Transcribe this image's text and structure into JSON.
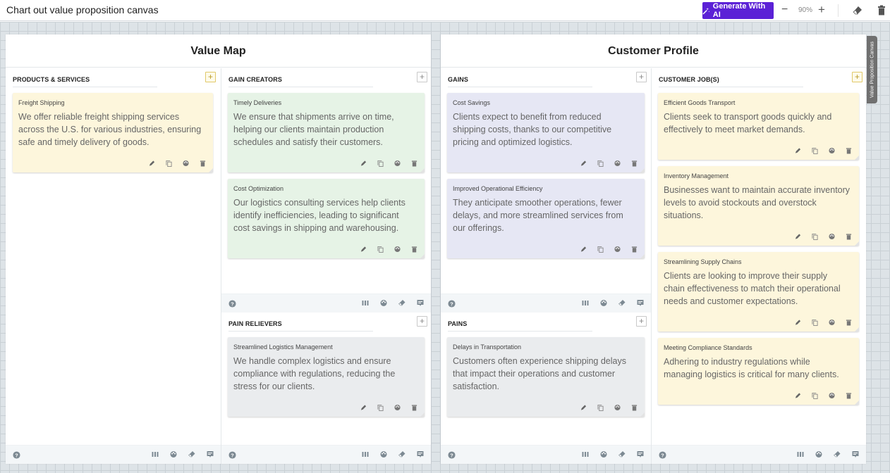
{
  "app": {
    "title": "Chart out value proposition canvas",
    "generate_button": "Generate With AI",
    "zoom_level": "90%",
    "zoom_out_label": "−",
    "zoom_in_label": "+",
    "side_tab": "Value Proposition Canvas"
  },
  "icons": {
    "generate": "magic-wand-icon",
    "eraser": "eraser-icon",
    "trash": "trash-icon",
    "edit": "pencil-icon",
    "copy": "copy-icon",
    "palette": "palette-icon",
    "help": "help-icon",
    "columns": "columns-icon",
    "comment": "comment-icon"
  },
  "colors": {
    "accent": "#5b21d6",
    "card_yellow": "#fdf6dc",
    "card_green": "#e6f3e6",
    "card_purple": "#e6e7f4",
    "card_gray": "#eaecee"
  },
  "value_map": {
    "title": "Value Map",
    "products_services": {
      "header": "PRODUCTS & SERVICES",
      "add_label": "+",
      "cards": [
        {
          "title": "Freight Shipping",
          "body": "We offer reliable freight shipping services across the U.S. for various industries, ensuring safe and timely delivery of goods."
        }
      ]
    },
    "gain_creators": {
      "header": "GAIN CREATORS",
      "add_label": "+",
      "cards": [
        {
          "title": "Timely Deliveries",
          "body": "We ensure that shipments arrive on time, helping our clients maintain production schedules and satisfy their customers."
        },
        {
          "title": "Cost Optimization",
          "body": "Our logistics consulting services help clients identify inefficiencies, leading to significant cost savings in shipping and warehousing."
        }
      ]
    },
    "pain_relievers": {
      "header": "PAIN RELIEVERS",
      "add_label": "+",
      "cards": [
        {
          "title": "Streamlined Logistics Management",
          "body": "We handle complex logistics and ensure compliance with regulations, reducing the stress for our clients."
        }
      ]
    }
  },
  "customer_profile": {
    "title": "Customer Profile",
    "gains": {
      "header": "GAINS",
      "add_label": "+",
      "cards": [
        {
          "title": "Cost Savings",
          "body": "Clients expect to benefit from reduced shipping costs, thanks to our competitive pricing and optimized logistics."
        },
        {
          "title": "Improved Operational Efficiency",
          "body": "They anticipate smoother operations, fewer delays, and more streamlined services from our offerings."
        }
      ]
    },
    "pains": {
      "header": "PAINS",
      "add_label": "+",
      "cards": [
        {
          "title": "Delays in Transportation",
          "body": "Customers often experience shipping delays that impact their operations and customer satisfaction."
        }
      ]
    },
    "customer_jobs": {
      "header": "CUSTOMER JOB(S)",
      "add_label": "+",
      "cards": [
        {
          "title": "Efficient Goods Transport",
          "body": "Clients seek to transport goods quickly and effectively to meet market demands."
        },
        {
          "title": "Inventory Management",
          "body": "Businesses want to maintain accurate inventory levels to avoid stockouts and overstock situations."
        },
        {
          "title": "Streamlining Supply Chains",
          "body": "Clients are looking to improve their supply chain effectiveness to match their operational needs and customer expectations."
        },
        {
          "title": "Meeting Compliance Standards",
          "body": "Adhering to industry regulations while managing logistics is critical for many clients."
        }
      ]
    }
  }
}
